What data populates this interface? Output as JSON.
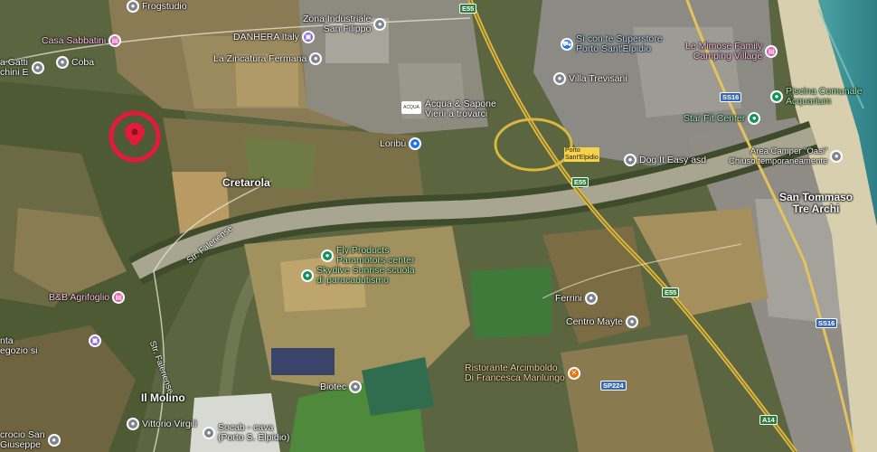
{
  "colors": {
    "sea": "#3a8e8f",
    "beach": "#d8cfae",
    "river": "#a8a690",
    "highway": "#d9b741",
    "marker": "#e11b39",
    "pin_gray": "#7d8590",
    "pin_green": "#13915a",
    "pin_pink": "#d455a8",
    "pin_purple": "#8a5fd6",
    "pin_blue": "#1a73e8",
    "pin_orange": "#e8710a"
  },
  "selected_marker": {
    "icon": "red-location-marker-icon"
  },
  "towns": {
    "cretarola": "Cretarola",
    "san_tommaso": "San Tommaso\nTre Archi",
    "il_molino": "Il Molino"
  },
  "streets": {
    "str_faleriense_1": "Str. Faleriense",
    "str_faleriense_2": "Str. Faleriense"
  },
  "road_shields": {
    "e55_top": "E55",
    "e55_mid": "E55",
    "e55_lower": "E55",
    "ss16_top": "SS16",
    "ss16_lower": "SS16",
    "sp224": "SP224",
    "a14": "A14",
    "exit_sign": "Porto\nSant'Elpidio"
  },
  "acqua_sapone_emblem": "ACQUA",
  "pois": {
    "frogstudio": "Frogstudio",
    "zona_industriale": "Zona Industriale\nSan Filippo",
    "danhera": "DANHERA Italy",
    "casa_sabbatini": "Casa Sabbatini",
    "coba": "Coba",
    "gatti_chini": "a Gatti\nchini E",
    "zincatura": "La Zincatura Fermana",
    "sicon": "Sì con te Superstore\nPorto Sant'Elpidio",
    "mimose": "Le Mimose Family\nCamping Village",
    "villa_trevisani": "Villa Trevisani",
    "acqua_sapone": "Acqua & Sapone\nVieni a trovarci",
    "piscina": "Piscina Comunale\nAcquarium",
    "star_fit": "Star Fit Center",
    "loribu": "Loribù",
    "dog_it_easy": "Dog It Easy asd",
    "area_camper": "Area Camper \"Oasi\"\nChiuso temporaneamente",
    "fly_products": "Fly Products\nParamotors center",
    "skydive": "Skydive Sunrise scuola\ndi paracadutismo",
    "bb_agrifoglio": "B&B Agrifoglio",
    "ferrini": "Ferrini",
    "centro_mayte": "Centro Mayte",
    "nta_negozio": "nta\negozio si",
    "ristorante": "Ristorante Arcimboldo\nDi Francesca Marilungo",
    "biotec": "Biotec",
    "vittorio_virgili": "Vittorio Virgili",
    "socab": "Socab - cava\n(Porto S. Elpidio)",
    "crocicchio": "crocio San\nGiuseppe"
  }
}
